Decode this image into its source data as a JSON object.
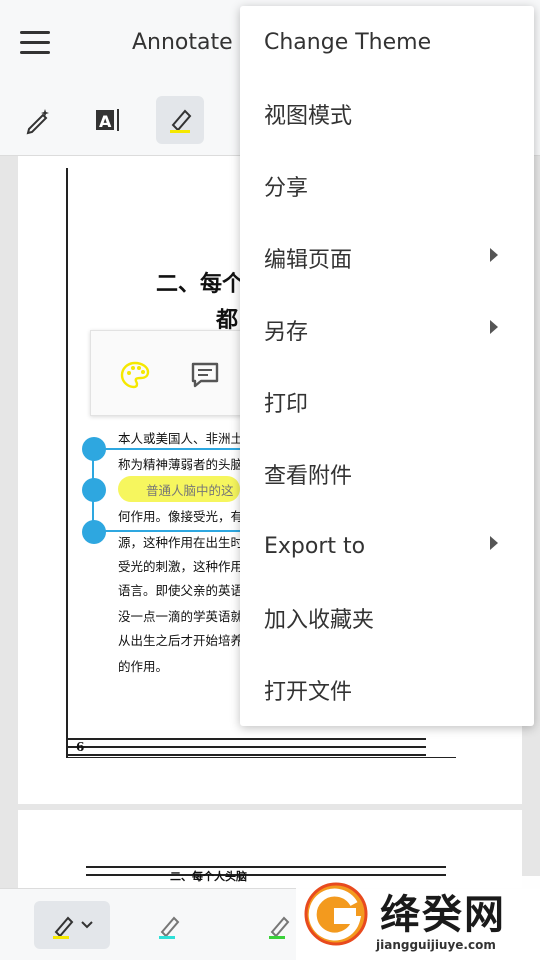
{
  "app": {
    "title": "Annotate"
  },
  "toolbar": {
    "tools": [
      "magic-pen-icon",
      "text-select-icon",
      "highlighter-icon",
      "more-tool-icon"
    ],
    "highlighter_color": "#f5f542"
  },
  "document": {
    "heading_line1": "二、每个",
    "heading_line2": "都",
    "lines": [
      "本人或美国人、非洲土",
      "称为精神薄弱者的头脑",
      "普通人脑中的这",
      "何作用。像接受光，有",
      "源，这种作用在出生时",
      "受光的刺激，这种作用",
      "语言。即使父亲的英语",
      "没一点一滴的学英语就",
      "从出生之后才开始培养",
      "的作用。"
    ],
    "page_number": "6",
    "page2_heading": "二、每个人头脑"
  },
  "annotation_popup": {
    "buttons": [
      "palette-icon",
      "comment-icon"
    ],
    "palette_color": "#f5e800"
  },
  "menu": {
    "items": [
      {
        "label": "Change Theme",
        "submenu": false
      },
      {
        "label": "视图模式",
        "submenu": false
      },
      {
        "label": "分享",
        "submenu": false
      },
      {
        "label": "编辑页面",
        "submenu": true
      },
      {
        "label": "另存",
        "submenu": true
      },
      {
        "label": "打印",
        "submenu": false
      },
      {
        "label": "查看附件",
        "submenu": false
      },
      {
        "label": "Export to",
        "submenu": true
      },
      {
        "label": "加入收藏夹",
        "submenu": false
      },
      {
        "label": "打开文件",
        "submenu": false
      }
    ]
  },
  "bottom_toolbar": {
    "pens": [
      {
        "name": "pen-yellow",
        "color": "#f5e800"
      },
      {
        "name": "pen-cyan",
        "color": "#2ee0d8"
      },
      {
        "name": "pen-green",
        "color": "#3ad13a"
      }
    ]
  },
  "watermark": {
    "title": "绛癸网",
    "url": "jiangguijiuye.com"
  }
}
